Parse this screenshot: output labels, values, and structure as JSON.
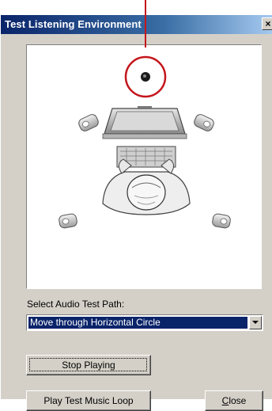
{
  "window": {
    "title": "Test Listening Environment",
    "close_glyph": "×",
    "annotation_color": "#c4161c"
  },
  "scene": {
    "speakers": [
      "front-center",
      "front-left",
      "front-right",
      "rear-left",
      "rear-right"
    ],
    "highlighted_speaker": "front-center",
    "listener": "person-at-desk"
  },
  "form": {
    "path_label": "Select Audio Test Path:",
    "path_selected": "Move through Horizontal Circle"
  },
  "buttons": {
    "stop": "Stop Playing",
    "play": "Play Test Music Loop",
    "close_prefix": "",
    "close_mnemonic": "C",
    "close_rest": "lose"
  },
  "colors": {
    "title_bar": "#0a246a",
    "selection": "#0a246a",
    "dialog_face": "#d4d0c8"
  }
}
